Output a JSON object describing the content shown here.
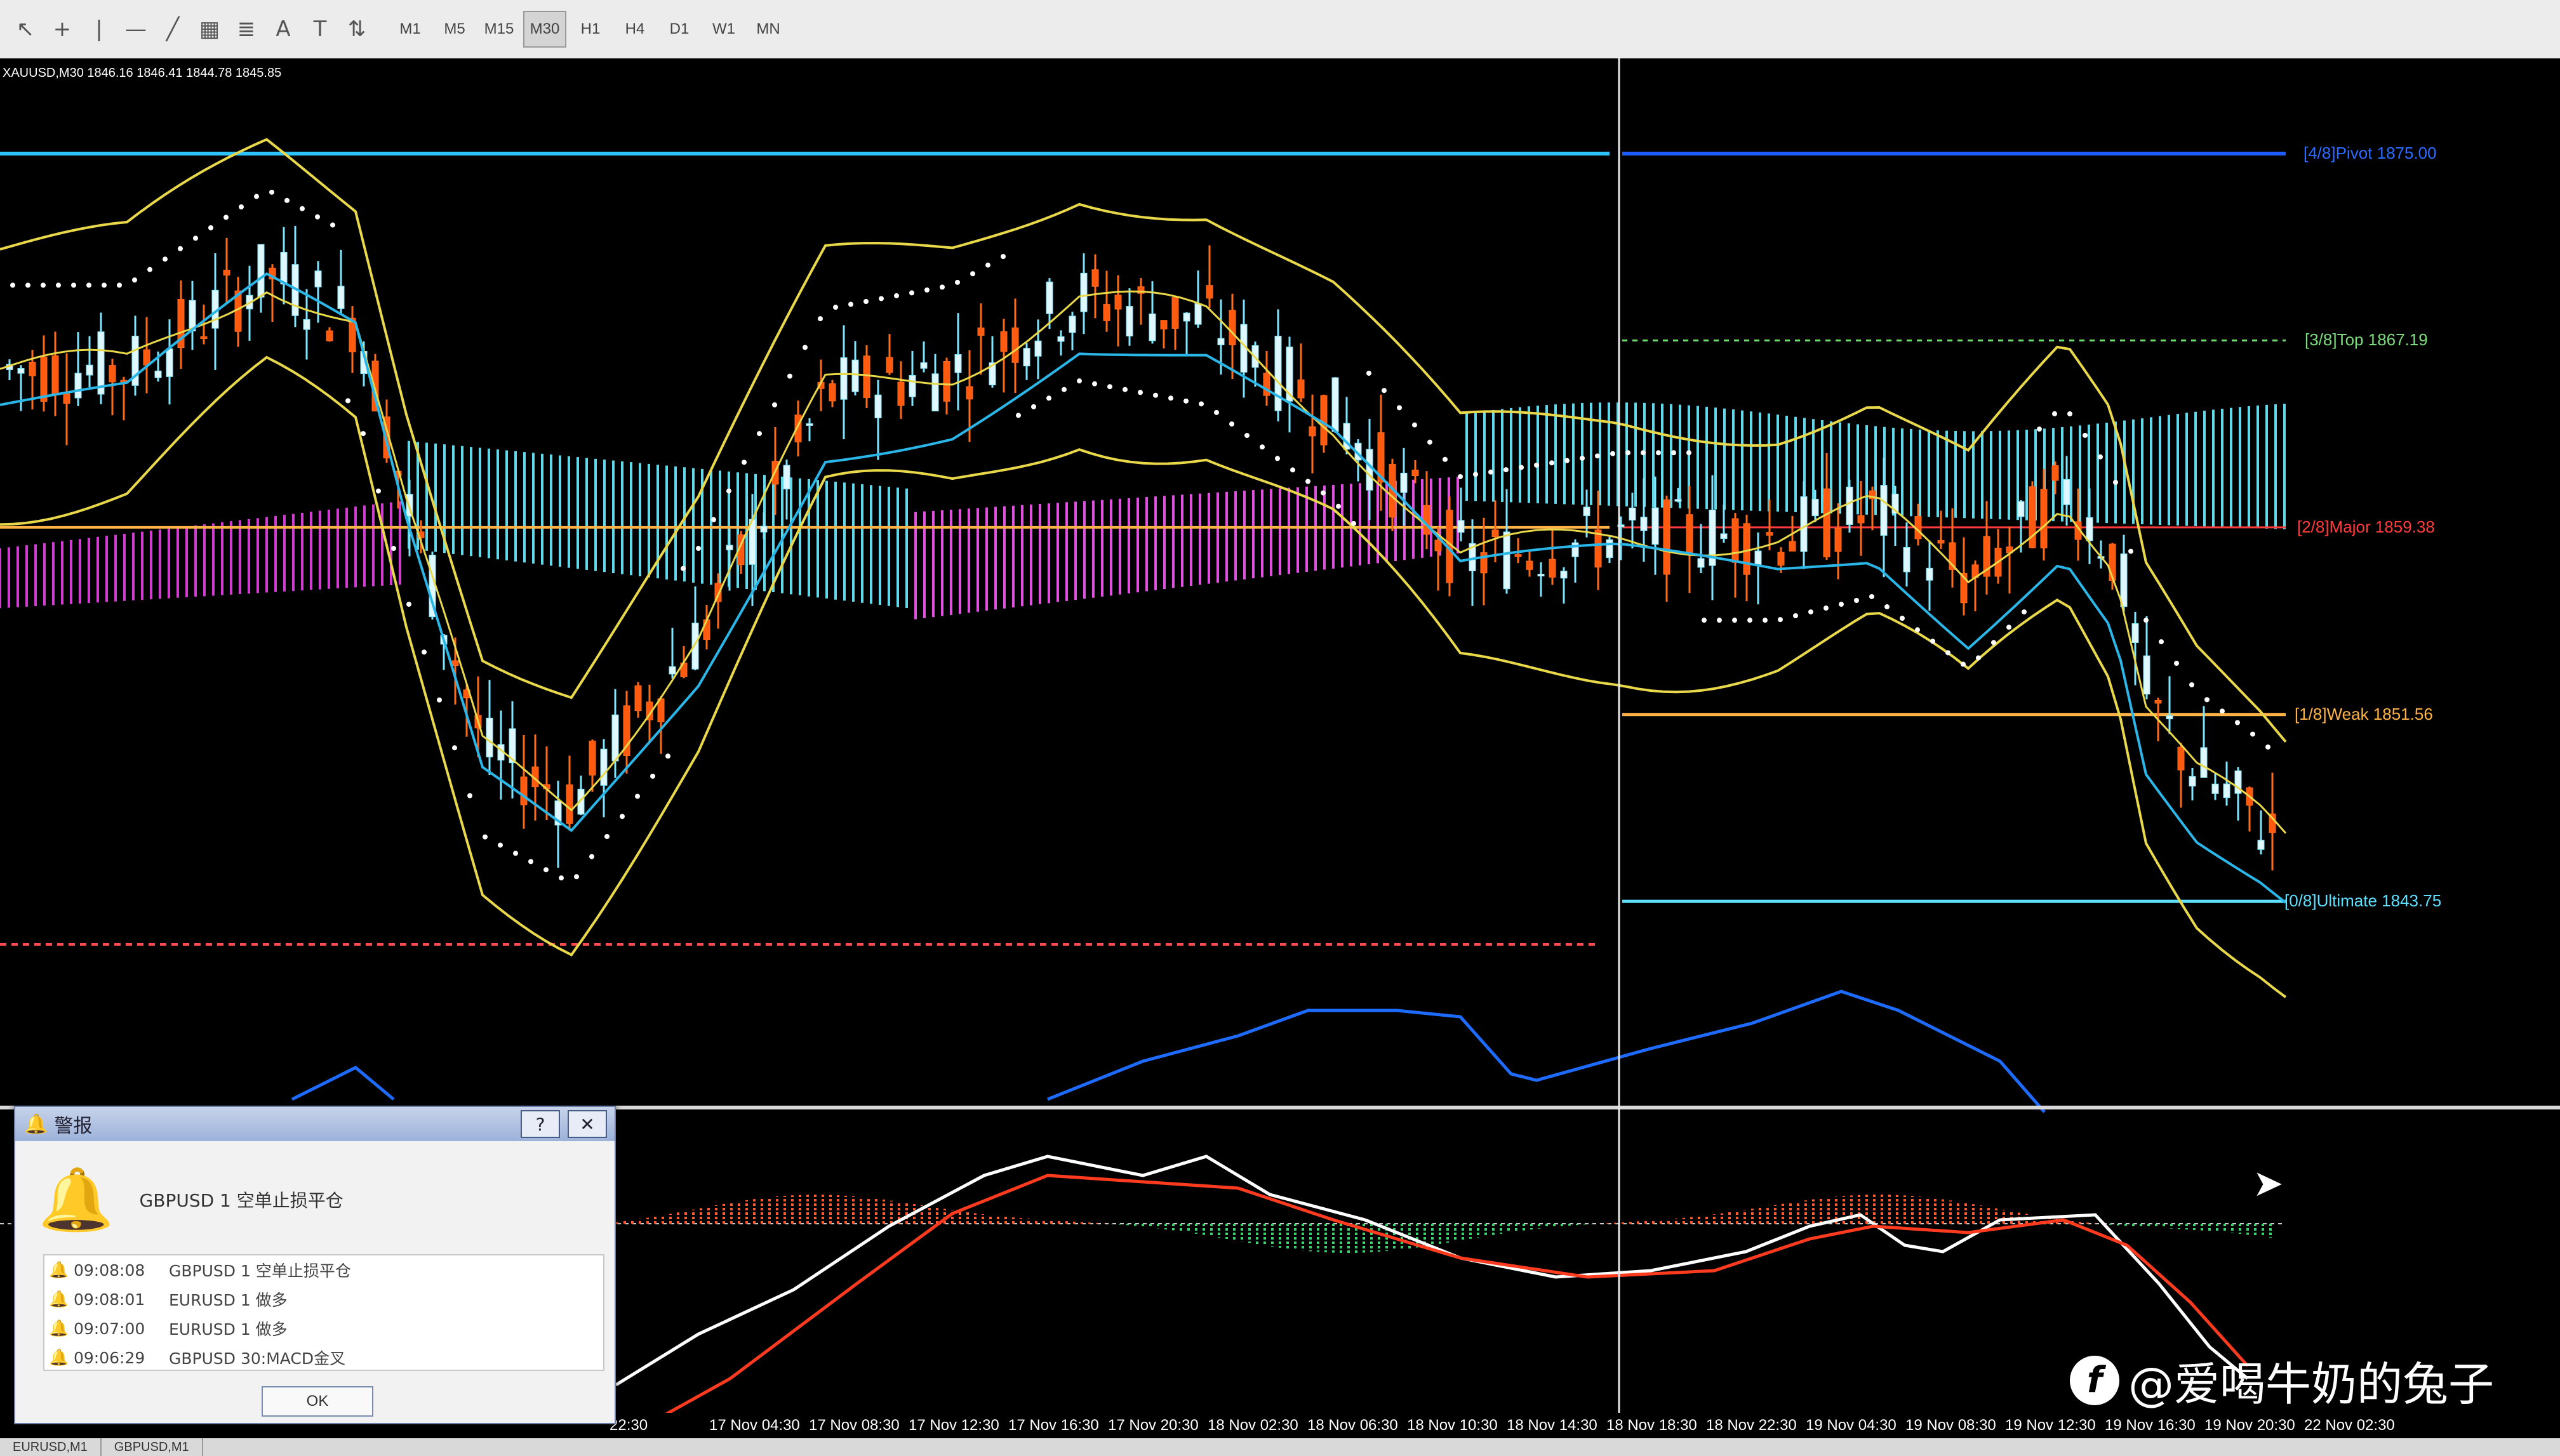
{
  "toolbar": {
    "icons": [
      "arrow-cursor-icon",
      "crosshair-icon",
      "vertical-line-icon",
      "horizontal-line-icon",
      "trendline-icon",
      "channel-icon",
      "fibonacci-icon",
      "text-icon",
      "text-label-icon",
      "arrows-icon"
    ],
    "timeframes": [
      "M1",
      "M5",
      "M15",
      "M30",
      "H1",
      "H4",
      "D1",
      "W1",
      "MN"
    ],
    "active_timeframe": "M30"
  },
  "chart": {
    "ohlc_text": "XAUUSD,M30  1846.16 1846.41 1844.78 1845.85",
    "time_labels": [
      "22:30",
      "17 Nov 04:30",
      "17 Nov 08:30",
      "17 Nov 12:30",
      "17 Nov 16:30",
      "17 Nov 20:30",
      "18 Nov 02:30",
      "18 Nov 06:30",
      "18 Nov 10:30",
      "18 Nov 14:30",
      "18 Nov 18:30",
      "18 Nov 22:30",
      "19 Nov 04:30",
      "19 Nov 08:30",
      "19 Nov 12:30",
      "19 Nov 16:30",
      "19 Nov 20:30",
      "22 Nov 02:30"
    ],
    "murrey_levels": [
      {
        "label": "[4/8]Pivot 1875.00",
        "color": "#2a6cff"
      },
      {
        "label": "[3/8]Top 1867.19",
        "color": "#7bdc7b"
      },
      {
        "label": "[2/8]Major 1859.38",
        "color": "#ff3b3b"
      },
      {
        "label": "[1/8]Weak 1851.56",
        "color": "#ffb347"
      },
      {
        "label": "[0/8]Ultimate 1843.75",
        "color": "#5fe0ff"
      }
    ]
  },
  "chart_tabs": [
    "EURUSD,M1",
    "GBPUSD,M1"
  ],
  "alert": {
    "title": "警报",
    "help_label": "?",
    "close_label": "✕",
    "message": "GBPUSD 1 空单止损平仓",
    "rows": [
      {
        "time": "09:08:08",
        "text": "GBPUSD 1 空单止损平仓"
      },
      {
        "time": "09:08:01",
        "text": "EURUSD 1 做多"
      },
      {
        "time": "09:07:00",
        "text": "EURUSD 1 做多"
      },
      {
        "time": "09:06:29",
        "text": "GBPUSD 30:MACD金叉"
      }
    ],
    "ok_label": "OK"
  },
  "watermark": {
    "text": "@爱喝牛奶的兔子"
  }
}
